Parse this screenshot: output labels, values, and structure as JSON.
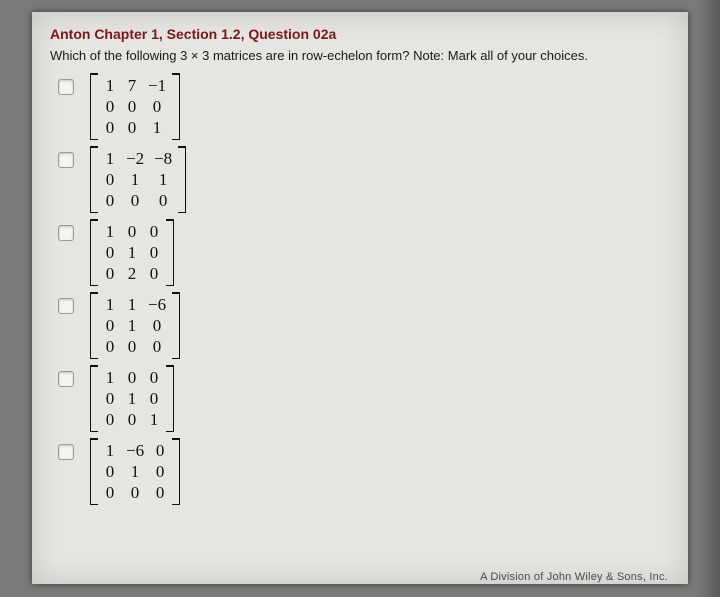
{
  "question": {
    "title": "Anton Chapter 1, Section 1.2, Question 02a",
    "text": "Which of the following 3 × 3 matrices are in row-echelon form? Note: Mark all of your choices."
  },
  "options": [
    {
      "matrix": [
        [
          "1",
          "7",
          "−1"
        ],
        [
          "0",
          "0",
          "0"
        ],
        [
          "0",
          "0",
          "1"
        ]
      ]
    },
    {
      "matrix": [
        [
          "1",
          "−2",
          "−8"
        ],
        [
          "0",
          "1",
          "1"
        ],
        [
          "0",
          "0",
          "0"
        ]
      ]
    },
    {
      "matrix": [
        [
          "1",
          "0",
          "0"
        ],
        [
          "0",
          "1",
          "0"
        ],
        [
          "0",
          "2",
          "0"
        ]
      ]
    },
    {
      "matrix": [
        [
          "1",
          "1",
          "−6"
        ],
        [
          "0",
          "1",
          "0"
        ],
        [
          "0",
          "0",
          "0"
        ]
      ]
    },
    {
      "matrix": [
        [
          "1",
          "0",
          "0"
        ],
        [
          "0",
          "1",
          "0"
        ],
        [
          "0",
          "0",
          "1"
        ]
      ]
    },
    {
      "matrix": [
        [
          "1",
          "−6",
          "0"
        ],
        [
          "0",
          "1",
          "0"
        ],
        [
          "0",
          "0",
          "0"
        ]
      ]
    }
  ],
  "footer": "A Division of John Wiley & Sons, Inc."
}
